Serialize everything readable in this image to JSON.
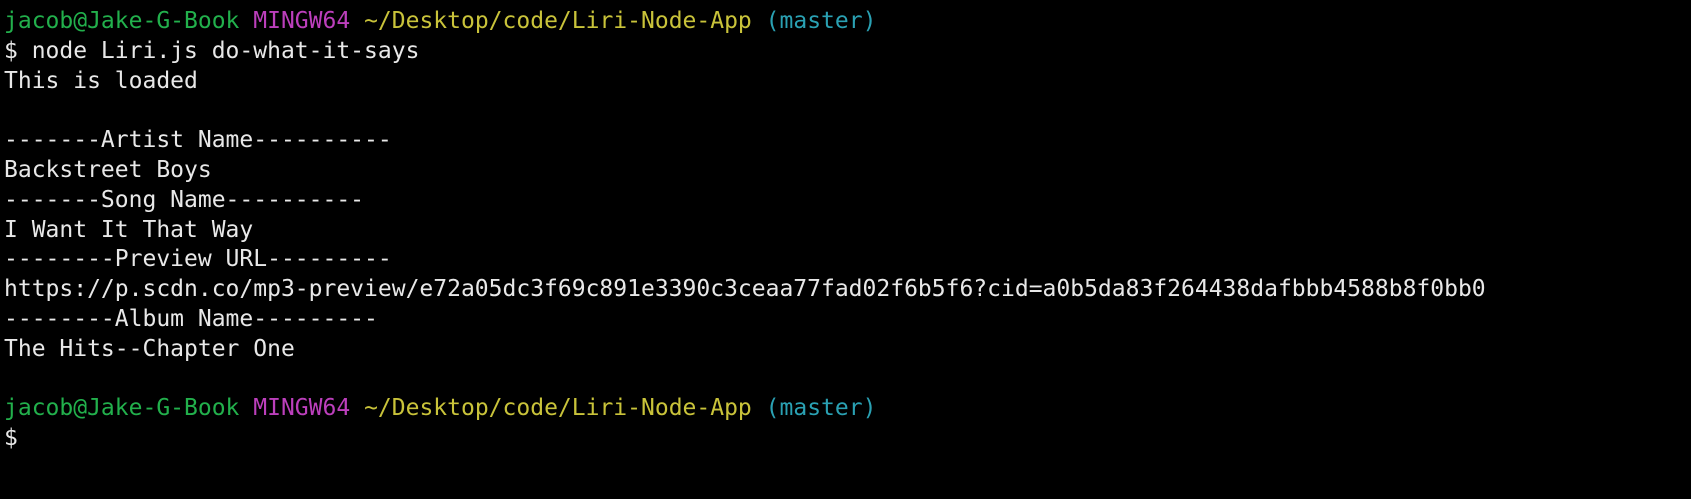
{
  "prompt_top": {
    "user_host": "jacob@Jake-G-Book",
    "shell": "MINGW64",
    "path": "~/Desktop/code/Liri-Node-App",
    "branch": "(master)"
  },
  "command": "$ node Liri.js do-what-it-says",
  "output": {
    "loaded": "This is loaded",
    "blank1": "",
    "artist_header": "-------Artist Name----------",
    "artist_value": "Backstreet Boys",
    "song_header": "-------Song Name----------",
    "song_value": "I Want It That Way",
    "preview_header": "--------Preview URL---------",
    "preview_value": "https://p.scdn.co/mp3-preview/e72a05dc3f69c891e3390c3ceaa77fad02f6b5f6?cid=a0b5da83f264438dafbbb4588b8f0bb0",
    "album_header": "--------Album Name---------",
    "album_value": "The Hits--Chapter One",
    "blank2": ""
  },
  "prompt_bottom": {
    "user_host": "jacob@Jake-G-Book",
    "shell": "MINGW64",
    "path": "~/Desktop/code/Liri-Node-App",
    "branch": "(master)"
  },
  "input_prompt": "$",
  "colors": {
    "background": "#000000",
    "text": "#e8e8e8",
    "user_host": "#22b04c",
    "shell": "#bc3fbc",
    "path": "#c9c33a",
    "branch": "#2aa1b3"
  }
}
